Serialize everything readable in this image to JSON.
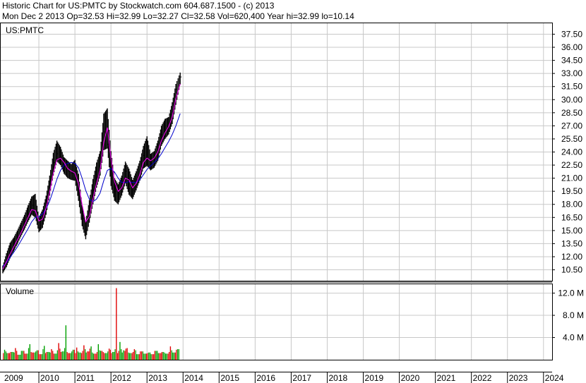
{
  "header": {
    "line1": "Historic Chart for US:PMTC by Stockwatch.com 604.687.1500 - (c) 2013",
    "line2": "Mon Dec  2 2013   Op=32.53   Hi=32.99   Lo=32.27   Cl=32.58   Vol=620,400   Year hi=32.99   lo=10.14"
  },
  "chart_data": {
    "type": "line",
    "price_panel_label": "US:PMTC",
    "volume_panel_label": "Volume",
    "x_tick_labels": [
      "2009",
      "2010",
      "2011",
      "2012",
      "2013",
      "2014",
      "2015",
      "2016",
      "2017",
      "2018",
      "2019",
      "2020",
      "2021",
      "2022",
      "2023",
      "2024"
    ],
    "xlim": [
      2009,
      2024.2
    ],
    "price_axis": {
      "ylim": [
        9.25,
        38.75
      ],
      "tick_labels": [
        "10.50",
        "12.00",
        "13.50",
        "15.00",
        "16.50",
        "18.00",
        "19.50",
        "21.00",
        "22.50",
        "24.00",
        "25.50",
        "27.00",
        "28.50",
        "30.00",
        "31.50",
        "33.00",
        "34.50",
        "36.00",
        "37.50"
      ],
      "ticks": [
        10.5,
        12,
        13.5,
        15,
        16.5,
        18,
        19.5,
        21,
        22.5,
        24,
        25.5,
        27,
        28.5,
        30,
        31.5,
        33,
        34.5,
        36,
        37.5
      ]
    },
    "volume_axis": {
      "ylim": [
        0,
        13.6
      ],
      "tick_labels": [
        "4.0 M",
        "8.0 M",
        "12.0 M"
      ],
      "ticks": [
        4,
        8,
        12
      ]
    },
    "price_series": {
      "x": [
        2009.0,
        2009.1,
        2009.2,
        2009.3,
        2009.4,
        2009.5,
        2009.6,
        2009.7,
        2009.8,
        2009.9,
        2010.0,
        2010.1,
        2010.2,
        2010.3,
        2010.4,
        2010.5,
        2010.6,
        2010.7,
        2010.8,
        2010.9,
        2011.0,
        2011.1,
        2011.2,
        2011.3,
        2011.4,
        2011.5,
        2011.6,
        2011.7,
        2011.8,
        2011.9,
        2012.0,
        2012.1,
        2012.2,
        2012.3,
        2012.4,
        2012.5,
        2012.6,
        2012.7,
        2012.8,
        2012.9,
        2013.0,
        2013.1,
        2013.2,
        2013.3,
        2013.4,
        2013.5,
        2013.6,
        2013.7,
        2013.8,
        2013.92
      ],
      "high": [
        11.0,
        12.4,
        13.6,
        14.2,
        15.0,
        15.9,
        16.8,
        17.9,
        18.9,
        19.2,
        16.5,
        17.4,
        19.0,
        21.3,
        23.9,
        25.3,
        24.6,
        23.4,
        23.0,
        22.6,
        23.1,
        21.5,
        17.9,
        16.1,
        18.5,
        20.9,
        22.8,
        24.1,
        28.4,
        29.0,
        24.1,
        21.0,
        20.3,
        21.3,
        22.9,
        22.1,
        20.8,
        21.8,
        23.0,
        24.7,
        25.8,
        23.8,
        24.1,
        25.3,
        27.0,
        27.8,
        28.0,
        29.7,
        31.8,
        33.1
      ],
      "low": [
        10.1,
        10.8,
        11.8,
        12.6,
        13.4,
        14.3,
        15.1,
        16.0,
        16.8,
        16.5,
        14.8,
        15.3,
        16.8,
        19.0,
        21.3,
        22.9,
        22.5,
        21.5,
        21.0,
        20.8,
        20.7,
        18.4,
        15.5,
        14.0,
        15.9,
        18.0,
        19.9,
        21.3,
        24.2,
        24.4,
        20.1,
        18.4,
        18.0,
        19.0,
        20.4,
        19.1,
        18.6,
        19.6,
        20.7,
        22.1,
        22.4,
        21.9,
        22.2,
        23.0,
        24.7,
        25.5,
        26.0,
        27.2,
        29.4,
        31.7
      ],
      "close": [
        10.5,
        11.6,
        12.7,
        13.4,
        14.2,
        15.1,
        16.0,
        16.9,
        17.9,
        16.8,
        15.3,
        16.5,
        18.2,
        20.3,
        22.8,
        23.8,
        23.4,
        22.5,
        21.8,
        21.6,
        21.6,
        19.5,
        16.4,
        15.0,
        17.2,
        19.6,
        21.1,
        22.6,
        26.3,
        24.9,
        21.0,
        19.5,
        19.2,
        20.4,
        21.8,
        19.8,
        19.6,
        20.8,
        22.0,
        23.6,
        23.1,
        22.7,
        23.3,
        24.3,
        26.0,
        26.4,
        27.2,
        28.6,
        31.2,
        32.6
      ],
      "ma_short": [
        10.6,
        11.4,
        12.3,
        13.1,
        13.9,
        14.7,
        15.6,
        16.5,
        17.4,
        17.3,
        16.1,
        16.3,
        17.6,
        19.4,
        21.6,
        23.1,
        23.3,
        22.8,
        22.1,
        21.8,
        21.6,
        20.4,
        18.0,
        16.0,
        16.6,
        18.6,
        20.4,
        21.9,
        25.1,
        26.8,
        23.3,
        20.6,
        19.5,
        19.9,
        21.0,
        20.8,
        19.9,
        20.4,
        21.4,
        22.8,
        23.3,
        23.0,
        23.3,
        24.0,
        25.3,
        26.2,
        26.9,
        28.0,
        30.1,
        31.8
      ],
      "ma_long": [
        10.9,
        11.3,
        11.9,
        12.5,
        13.1,
        13.8,
        14.5,
        15.2,
        16.0,
        16.5,
        16.6,
        16.9,
        17.5,
        18.4,
        19.6,
        20.9,
        21.9,
        22.5,
        22.7,
        22.8,
        22.7,
        22.2,
        21.0,
        19.6,
        18.6,
        18.3,
        18.6,
        19.3,
        20.7,
        21.9,
        22.1,
        21.7,
        21.0,
        20.5,
        20.5,
        20.6,
        20.5,
        20.5,
        20.8,
        21.4,
        22.0,
        22.4,
        22.8,
        23.2,
        23.8,
        24.5,
        25.2,
        26.0,
        27.0,
        28.4
      ]
    },
    "volume_series": {
      "x": [
        2009.05,
        2009.15,
        2009.25,
        2009.35,
        2009.45,
        2009.55,
        2009.65,
        2009.75,
        2009.85,
        2009.95,
        2010.05,
        2010.15,
        2010.25,
        2010.35,
        2010.45,
        2010.55,
        2010.65,
        2010.75,
        2010.85,
        2010.95,
        2011.05,
        2011.15,
        2011.25,
        2011.35,
        2011.45,
        2011.55,
        2011.65,
        2011.75,
        2011.85,
        2011.95,
        2012.05,
        2012.15,
        2012.25,
        2012.35,
        2012.45,
        2012.55,
        2012.65,
        2012.75,
        2012.85,
        2012.95,
        2013.05,
        2013.15,
        2013.25,
        2013.35,
        2013.45,
        2013.55,
        2013.65,
        2013.75,
        2013.85
      ],
      "values": [
        1.8,
        1.2,
        1.4,
        2.1,
        0.9,
        1.6,
        1.1,
        2.8,
        1.3,
        1.7,
        1.0,
        2.5,
        1.4,
        1.9,
        1.1,
        3.0,
        1.5,
        6.2,
        1.2,
        1.8,
        2.2,
        1.3,
        2.6,
        1.5,
        2.4,
        1.1,
        2.8,
        1.6,
        1.2,
        2.0,
        1.4,
        12.9,
        3.2,
        1.7,
        2.1,
        1.2,
        1.9,
        1.0,
        1.5,
        1.1,
        1.3,
        1.0,
        1.6,
        1.2,
        1.4,
        1.1,
        2.4,
        1.3,
        1.9
      ],
      "up": [
        1,
        0,
        1,
        0,
        1,
        1,
        0,
        1,
        0,
        1,
        0,
        1,
        1,
        0,
        1,
        0,
        1,
        1,
        0,
        1,
        0,
        1,
        0,
        0,
        1,
        0,
        1,
        0,
        1,
        0,
        1,
        0,
        1,
        1,
        0,
        1,
        0,
        1,
        0,
        1,
        1,
        0,
        1,
        0,
        1,
        1,
        0,
        1,
        1
      ]
    },
    "colors": {
      "price": "#000000",
      "ma_short": "#ff00ff",
      "ma_long": "#0000cc",
      "vol_up": "#00a000",
      "vol_down": "#e00000",
      "grid": "#c8c8c8",
      "frame": "#000000"
    }
  }
}
